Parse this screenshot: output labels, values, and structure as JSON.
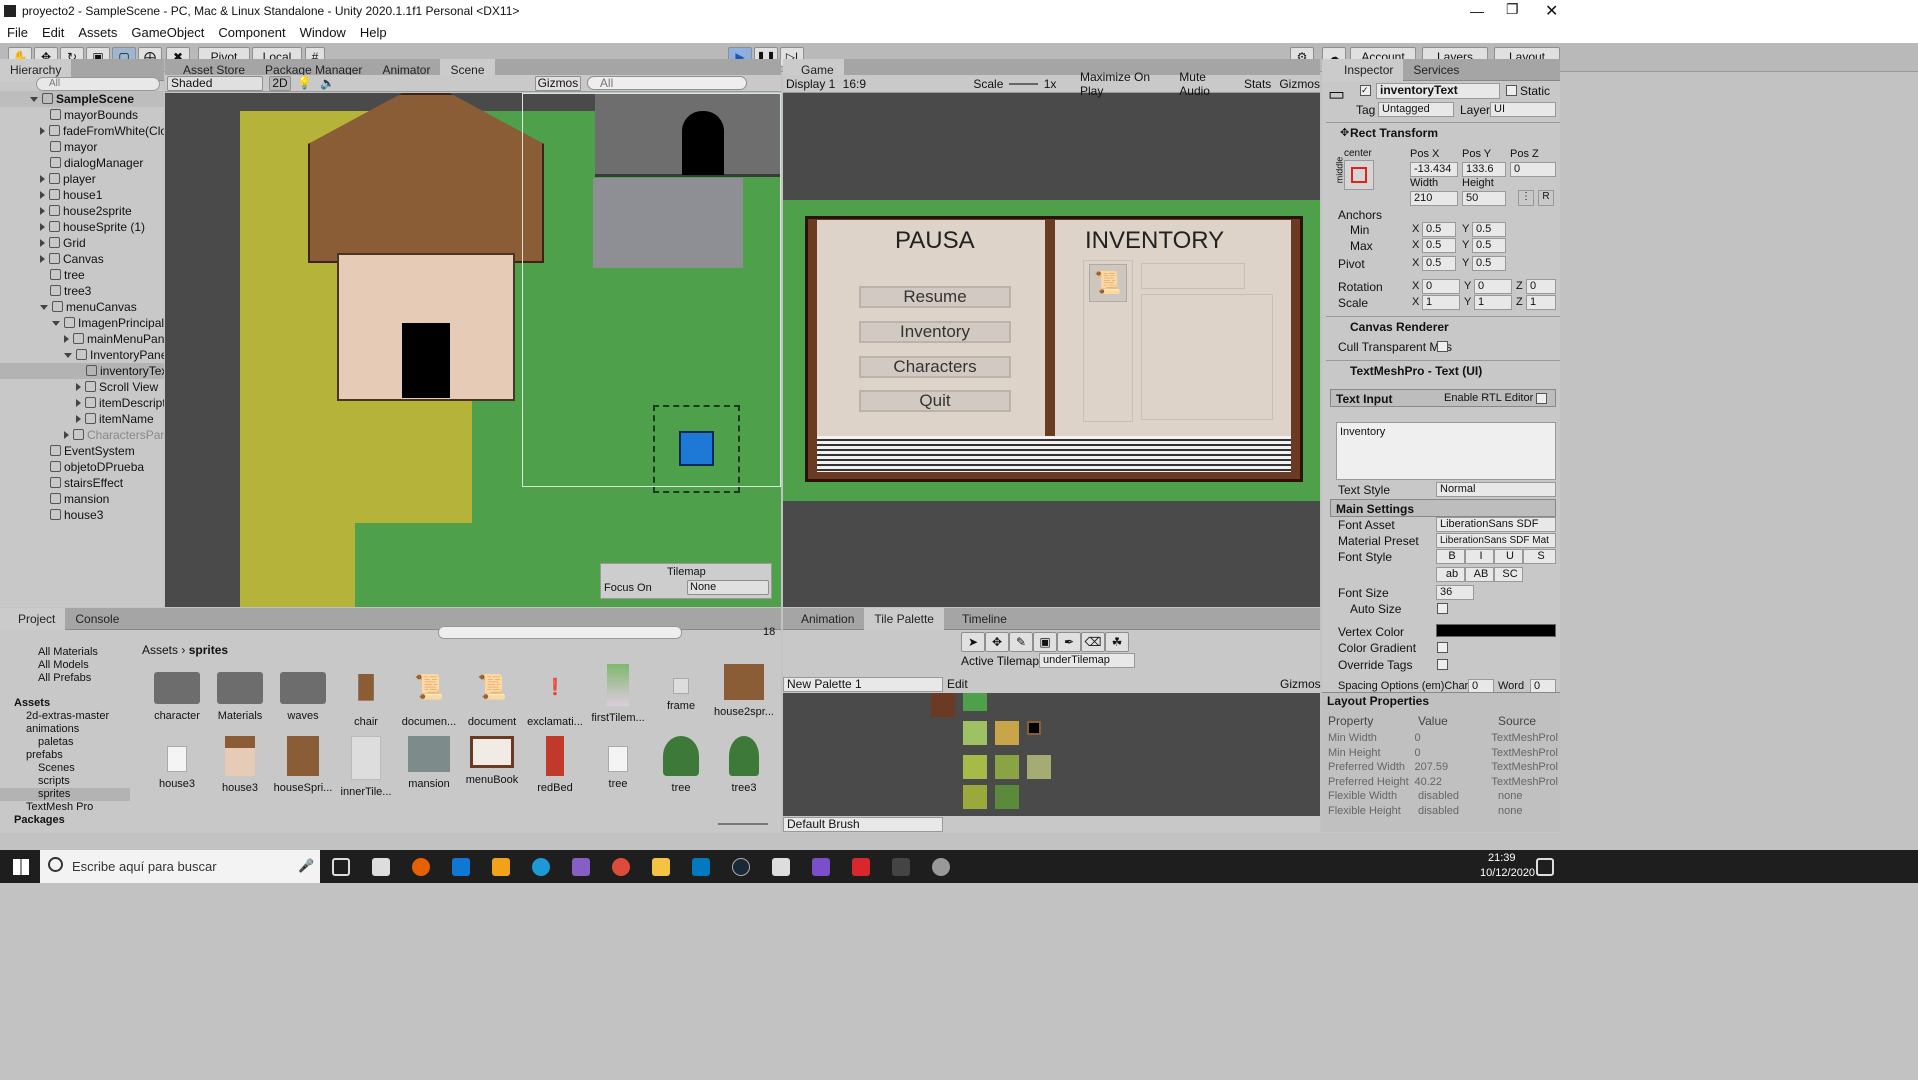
{
  "window": {
    "title": "proyecto2 - SampleScene - PC, Mac & Linux Standalone - Unity 2020.1.1f1 Personal <DX11>"
  },
  "menu": [
    "File",
    "Edit",
    "Assets",
    "GameObject",
    "Component",
    "Window",
    "Help"
  ],
  "toolbar": {
    "pivot": "Pivot",
    "local": "Local",
    "account": "Account",
    "layers": "Layers",
    "layout": "Layout"
  },
  "hierarchy": {
    "tab": "Hierarchy",
    "search": "All",
    "scene": "SampleScene",
    "items": [
      "mayorBounds",
      "fadeFromWhite(Clone",
      "mayor",
      "dialogManager",
      "player",
      "house1",
      "house2sprite",
      "houseSprite (1)",
      "Grid",
      "Canvas",
      "tree",
      "tree3",
      "menuCanvas",
      "ImagenPrincipal",
      "mainMenuPanel",
      "InventoryPanel",
      "inventoryText",
      "Scroll View",
      "itemDescriptic",
      "itemName",
      "CharactersPanel",
      "EventSystem",
      "objetoDPrueba",
      "stairsEffect",
      "mansion",
      "house3"
    ]
  },
  "scene_tabs": [
    "Asset Store",
    "Package Manager",
    "Animator",
    "Scene"
  ],
  "scene_bar": {
    "shading": "Shaded",
    "mode2d": "2D",
    "gizmos": "Gizmos",
    "search": "All"
  },
  "tilemap_overlay": {
    "title": "Tilemap",
    "focus_label": "Focus On",
    "focus_value": "None"
  },
  "game": {
    "tab": "Game",
    "display": "Display 1",
    "aspect": "16:9",
    "scale_label": "Scale",
    "scale": "1x",
    "maximize": "Maximize On Play",
    "mute": "Mute Audio",
    "stats": "Stats",
    "gizmos": "Gizmos",
    "book": {
      "left_title": "PAUSA",
      "right_title": "INVENTORY",
      "buttons": [
        "Resume",
        "Inventory",
        "Characters",
        "Quit"
      ]
    }
  },
  "inspector": {
    "tabs": [
      "Inspector",
      "Services"
    ],
    "object_name": "inventoryText",
    "static": "Static",
    "tag_label": "Tag",
    "tag": "Untagged",
    "layer_label": "Layer",
    "layer": "UI",
    "rect": {
      "title": "Rect Transform",
      "anchor": "center",
      "middle": "middle",
      "posx_l": "Pos X",
      "posy_l": "Pos Y",
      "posz_l": "Pos Z",
      "posx": "-13.434",
      "posy": "133.6",
      "posz": "0",
      "width_l": "Width",
      "height_l": "Height",
      "width": "210",
      "height": "50",
      "anchors": "Anchors",
      "min": "Min",
      "max": "Max",
      "pivot": "Pivot",
      "rotation": "Rotation",
      "scale": "Scale",
      "min_x": "0.5",
      "min_y": "0.5",
      "max_x": "0.5",
      "max_y": "0.5",
      "pivot_x": "0.5",
      "pivot_y": "0.5",
      "rot_x": "0",
      "rot_y": "0",
      "rot_z": "0",
      "sc_x": "1",
      "sc_y": "1",
      "sc_z": "1"
    },
    "canvas_renderer": {
      "title": "Canvas Renderer",
      "cull": "Cull Transparent Mes"
    },
    "tmp": {
      "title": "TextMeshPro - Text (UI)",
      "text_input": "Text Input",
      "rtl": "Enable RTL Editor",
      "text": "Inventory",
      "style_l": "Text Style",
      "style": "Normal",
      "main": "Main Settings",
      "font_asset_l": "Font Asset",
      "font_asset": "LiberationSans SDF",
      "material_l": "Material Preset",
      "material": "LiberationSans SDF Mat",
      "font_style_l": "Font Style",
      "styles": [
        "B",
        "I",
        "U",
        "S",
        "ab",
        "AB",
        "SC"
      ],
      "size_l": "Font Size",
      "size": "36",
      "auto": "Auto Size",
      "vertex": "Vertex Color",
      "gradient": "Color Gradient",
      "override": "Override Tags",
      "spacing": "Spacing Options (em)Charac",
      "word": "Word",
      "spacing_val": "0",
      "word_val": "0"
    },
    "layout": {
      "title": "Layout Properties",
      "headers": [
        "Property",
        "Value",
        "Source"
      ],
      "rows": [
        [
          "Min Width",
          "0",
          "TextMeshProl"
        ],
        [
          "Min Height",
          "0",
          "TextMeshProl"
        ],
        [
          "Preferred Width",
          "207.59",
          "TextMeshProl"
        ],
        [
          "Preferred Height",
          "40.22",
          "TextMeshProl"
        ],
        [
          "Flexible Width",
          "disabled",
          "none"
        ],
        [
          "Flexible Height",
          "disabled",
          "none"
        ]
      ]
    }
  },
  "project": {
    "tabs": [
      "Project",
      "Console"
    ],
    "favorites": [
      "All Materials",
      "All Models",
      "All Prefabs"
    ],
    "assets_root": "Assets",
    "folders": [
      "2d-extras-master",
      "animations",
      "paletas",
      "prefabs",
      "Scenes",
      "scripts",
      "sprites",
      "TextMesh Pro"
    ],
    "packages": "Packages",
    "breadcrumb": [
      "Assets",
      "sprites"
    ],
    "count": "18",
    "grid": [
      "character",
      "Materials",
      "waves",
      "chair",
      "documen...",
      "document",
      "exclamati...",
      "firstTilem...",
      "frame",
      "house2spr...",
      "house3",
      "house3",
      "houseSpri...",
      "innerTile...",
      "mansion",
      "menuBook",
      "redBed",
      "tree",
      "tree",
      "tree3"
    ]
  },
  "bottom_tabs": [
    "Animation",
    "Tile Palette",
    "Timeline"
  ],
  "palette": {
    "active_label": "Active Tilemap",
    "active": "underTilemap",
    "palette": "New Palette 1",
    "edit": "Edit",
    "gizmos": "Gizmos",
    "brush": "Default Brush"
  },
  "taskbar": {
    "search": "Escribe aquí para buscar",
    "time": "21:39",
    "date": "10/12/2020"
  }
}
